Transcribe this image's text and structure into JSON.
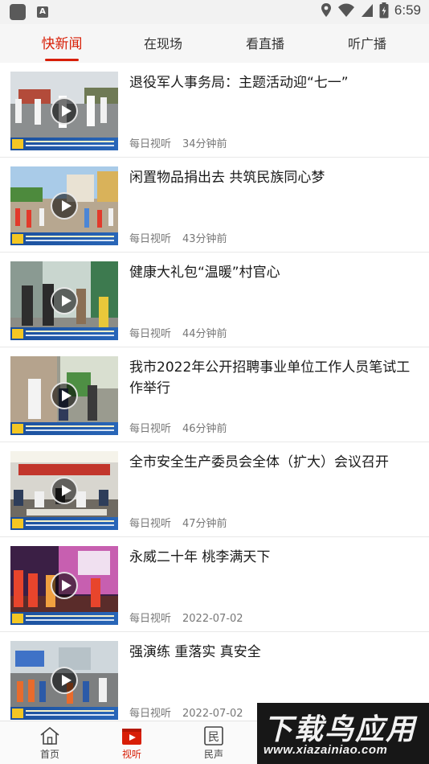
{
  "status_bar": {
    "time": "6:59"
  },
  "tabs": [
    {
      "label": "快新闻",
      "active": true
    },
    {
      "label": "在现场",
      "active": false
    },
    {
      "label": "看直播",
      "active": false
    },
    {
      "label": "听广播",
      "active": false
    }
  ],
  "news": [
    {
      "title": "退役军人事务局：主题活动迎“七一”",
      "source": "每日视听",
      "time": "34分钟前"
    },
    {
      "title": "闲置物品捐出去 共筑民族同心梦",
      "source": "每日视听",
      "time": "43分钟前"
    },
    {
      "title": "健康大礼包“温暖”村官心",
      "source": "每日视听",
      "time": "44分钟前"
    },
    {
      "title": "我市2022年公开招聘事业单位工作人员笔试工作举行",
      "source": "每日视听",
      "time": "46分钟前"
    },
    {
      "title": "全市安全生产委员会全体（扩大）会议召开",
      "source": "每日视听",
      "time": "47分钟前"
    },
    {
      "title": "永威二十年 桃李满天下",
      "source": "每日视听",
      "time": "2022-07-02"
    },
    {
      "title": "强演练 重落实 真安全",
      "source": "每日视听",
      "time": "2022-07-02"
    }
  ],
  "bottom_nav": [
    {
      "label": "首页",
      "icon": "home-icon",
      "active": false
    },
    {
      "label": "视听",
      "icon": "video-play-icon",
      "active": true
    },
    {
      "label": "民声",
      "icon": "min-sheng-icon",
      "active": false
    }
  ],
  "watermark": {
    "line1": "下载鸟应用",
    "line2": "www.xiazainiao.com"
  },
  "colors": {
    "accent": "#d81e06",
    "meta_text": "#777777",
    "caption_bar": "#1b4f9c"
  }
}
